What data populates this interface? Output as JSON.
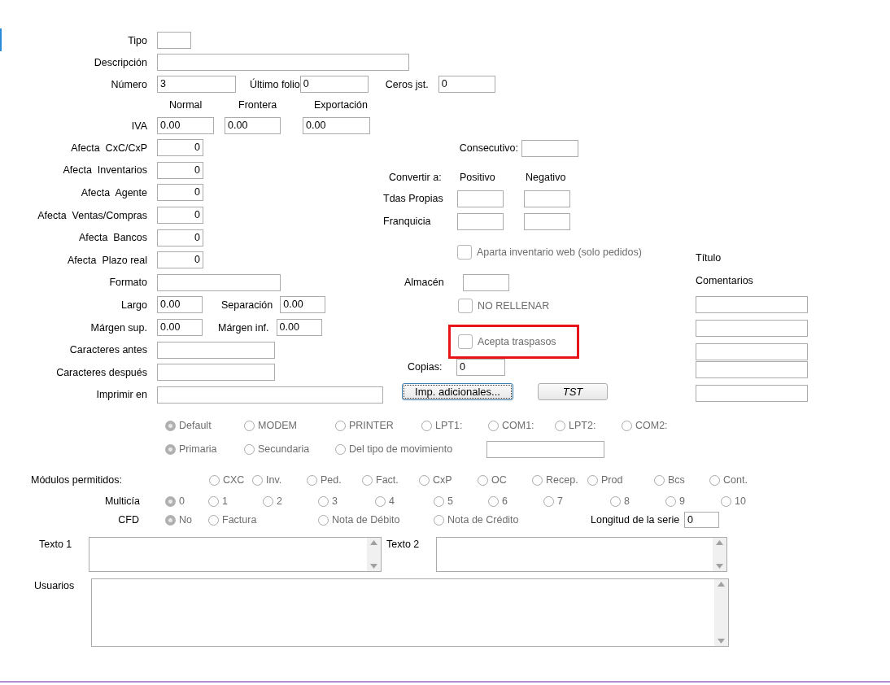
{
  "header": {
    "tipo": {
      "label": "Tipo"
    },
    "descripcion": {
      "label": "Descripción"
    },
    "numero": {
      "label": "Número",
      "value": "3"
    },
    "ultimo_folio": {
      "label": "Último folio",
      "value": "0"
    },
    "ceros_jst": {
      "label": "Ceros jst.",
      "value": "0"
    }
  },
  "iva": {
    "label": "IVA",
    "columns": [
      {
        "heading": "Normal",
        "value": "0.00"
      },
      {
        "heading": "Frontera",
        "value": "0.00"
      },
      {
        "heading": "Exportación",
        "value": "0.00"
      }
    ]
  },
  "afecta": [
    {
      "label": "Afecta  CxC/CxP",
      "value": "0"
    },
    {
      "label": "Afecta  Inventarios",
      "value": "0"
    },
    {
      "label": "Afecta  Agente",
      "value": "0"
    },
    {
      "label": "Afecta  Ventas/Compras",
      "value": "0"
    },
    {
      "label": "Afecta  Bancos",
      "value": "0"
    },
    {
      "label": "Afecta  Plazo real",
      "value": "0"
    }
  ],
  "print": {
    "formato": {
      "label": "Formato"
    },
    "largo": {
      "label": "Largo",
      "value": "0.00"
    },
    "separacion": {
      "label": "Separación",
      "value": "0.00"
    },
    "margen_sup": {
      "label": "Márgen sup.",
      "value": "0.00"
    },
    "margen_inf": {
      "label": "Márgen inf.",
      "value": "0.00"
    },
    "caracteres_antes": {
      "label": "Caracteres antes"
    },
    "caracteres_despues": {
      "label": "Caracteres después"
    },
    "imprimir_en": {
      "label": "Imprimir en"
    }
  },
  "middle": {
    "consecutivo": {
      "label": "Consecutivo:"
    },
    "convertir": {
      "label": "Convertir a:",
      "headings": [
        "Positivo",
        "Negativo"
      ],
      "rows": [
        {
          "label": "Tdas Propias"
        },
        {
          "label": "Franquicia"
        }
      ]
    },
    "aparta": {
      "label": "Aparta inventario web (solo pedidos)",
      "checked": false,
      "disabled": true
    },
    "almacen": {
      "label": "Almacén"
    },
    "no_rellenar": {
      "label": "NO RELLENAR",
      "checked": false,
      "disabled": true
    },
    "acepta_traspasos": {
      "label": "Acepta traspasos",
      "checked": false,
      "disabled": true,
      "highlighted": true
    },
    "copias": {
      "label": "Copias:",
      "value": "0"
    },
    "buttons": [
      {
        "label": "Imp. adicionales...",
        "focused": true,
        "italic": false
      },
      {
        "label": "TST",
        "focused": false,
        "italic": true
      }
    ]
  },
  "comments": {
    "title_label": "Título",
    "label": "Comentarios"
  },
  "port_options": {
    "disabled": true,
    "items": [
      {
        "label": "Default",
        "selected": true
      },
      {
        "label": "MODEM",
        "selected": false
      },
      {
        "label": "PRINTER",
        "selected": false
      },
      {
        "label": "LPT1:",
        "selected": false
      },
      {
        "label": "COM1:",
        "selected": false
      },
      {
        "label": "LPT2:",
        "selected": false
      },
      {
        "label": "COM2:",
        "selected": false
      }
    ]
  },
  "source_options": {
    "disabled": true,
    "items": [
      {
        "label": "Primaria",
        "selected": true
      },
      {
        "label": "Secundaria",
        "selected": false
      },
      {
        "label": "Del tipo de movimiento",
        "selected": false
      }
    ]
  },
  "modulos": {
    "label": "Módulos permitidos:",
    "disabled": true,
    "items": [
      {
        "label": "CXC",
        "selected": false
      },
      {
        "label": "Inv.",
        "selected": false
      },
      {
        "label": "Ped.",
        "selected": false
      },
      {
        "label": "Fact.",
        "selected": false
      },
      {
        "label": "CxP",
        "selected": false
      },
      {
        "label": "OC",
        "selected": false
      },
      {
        "label": "Recep.",
        "selected": false
      },
      {
        "label": "Prod",
        "selected": false
      },
      {
        "label": "Bcs",
        "selected": false
      },
      {
        "label": "Cont.",
        "selected": false
      }
    ]
  },
  "multicia": {
    "label": "Multicía",
    "disabled": true,
    "items": [
      {
        "label": "0",
        "selected": true
      },
      {
        "label": "1",
        "selected": false
      },
      {
        "label": "2",
        "selected": false
      },
      {
        "label": "3",
        "selected": false
      },
      {
        "label": "4",
        "selected": false
      },
      {
        "label": "5",
        "selected": false
      },
      {
        "label": "6",
        "selected": false
      },
      {
        "label": "7",
        "selected": false
      },
      {
        "label": "8",
        "selected": false
      },
      {
        "label": "9",
        "selected": false
      },
      {
        "label": "10",
        "selected": false
      }
    ]
  },
  "cfd": {
    "label": "CFD",
    "disabled": true,
    "items": [
      {
        "label": "No",
        "selected": true
      },
      {
        "label": "Factura",
        "selected": false
      },
      {
        "label": "Nota de Débito",
        "selected": false
      },
      {
        "label": "Nota de Crédito",
        "selected": false
      }
    ],
    "serie": {
      "label": "Longitud de la serie",
      "value": "0"
    }
  },
  "texts": [
    {
      "label": "Texto 1"
    },
    {
      "label": "Texto 2"
    }
  ],
  "usuarios": {
    "label": "Usuarios"
  }
}
